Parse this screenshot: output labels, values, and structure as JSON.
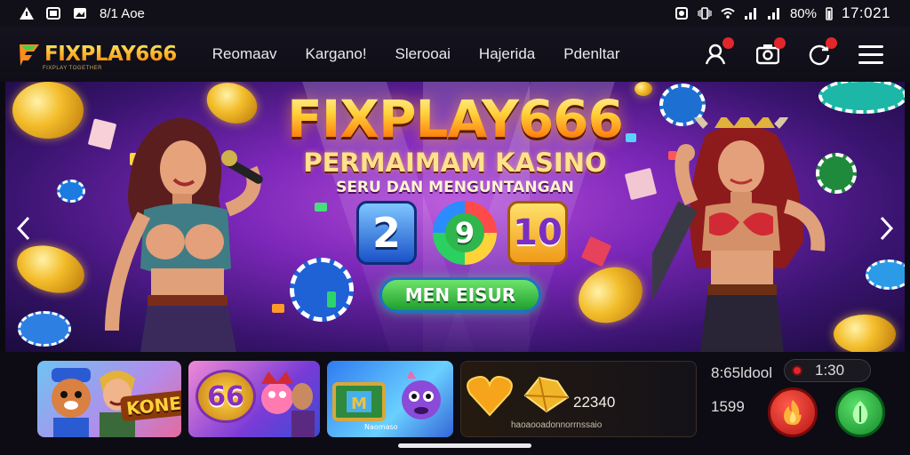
{
  "status_bar": {
    "app_label": "8/1 Aoe",
    "battery": "80%",
    "time": "17:021"
  },
  "header": {
    "logo": "FIXPLAY666",
    "logo_tagline": "FIXPLAY TOGETHER",
    "nav": [
      "Reomaav",
      "Kargano!",
      "Slerooai",
      "Hajerida",
      "Pdenltar"
    ],
    "icons": [
      "user-icon",
      "camera-icon",
      "refresh-icon",
      "menu-icon"
    ],
    "badge_color": "#e3262c"
  },
  "hero": {
    "title": "FIXPLAY666",
    "subtitle": "PERMAIMAM KASINO",
    "tagline": "SERU DAN MENGUNTANGAN",
    "tiles": [
      "2",
      "9",
      "10"
    ],
    "button": "MEN EISUR"
  },
  "bottom": {
    "cards": [
      {
        "label": "KONES"
      },
      {
        "label": "66"
      },
      {
        "label": "Naomaso"
      }
    ],
    "wallet_value": "22340",
    "wallet_caption": "haoaooadonnorrnssaio",
    "side_label": "8:65ldool",
    "side_value": "1599",
    "timer": "1:30",
    "fire_color": "#e0231f",
    "leaf_color": "#23b444"
  }
}
